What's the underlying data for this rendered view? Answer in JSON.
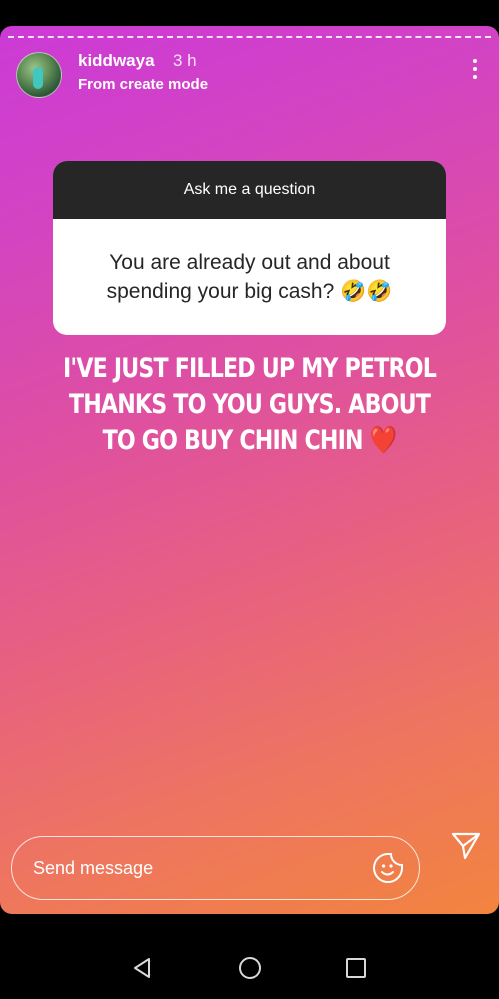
{
  "story": {
    "username": "kiddwaya",
    "time": "3 h",
    "subtitle": "From create mode",
    "question_header": "Ask me a question",
    "question_answer": "You are already out and about spending your big cash? 🤣🤣",
    "caption": "I'VE JUST FILLED UP MY PETROL THANKS TO YOU GUYS. ABOUT TO GO BUY CHIN CHIN ❤️"
  },
  "reply": {
    "placeholder": "Send message"
  },
  "icons": {
    "more": "more-vertical-icon",
    "sticker": "sticker-smile-icon",
    "send": "send-icon",
    "back": "back-triangle-icon",
    "home": "home-circle-icon",
    "recent": "recent-square-icon"
  },
  "colors": {
    "gradient_start": "#cc3ad6",
    "gradient_mid": "#de4fa2",
    "gradient_end": "#f2843f",
    "question_header_bg": "#262626",
    "question_body_bg": "#ffffff"
  }
}
